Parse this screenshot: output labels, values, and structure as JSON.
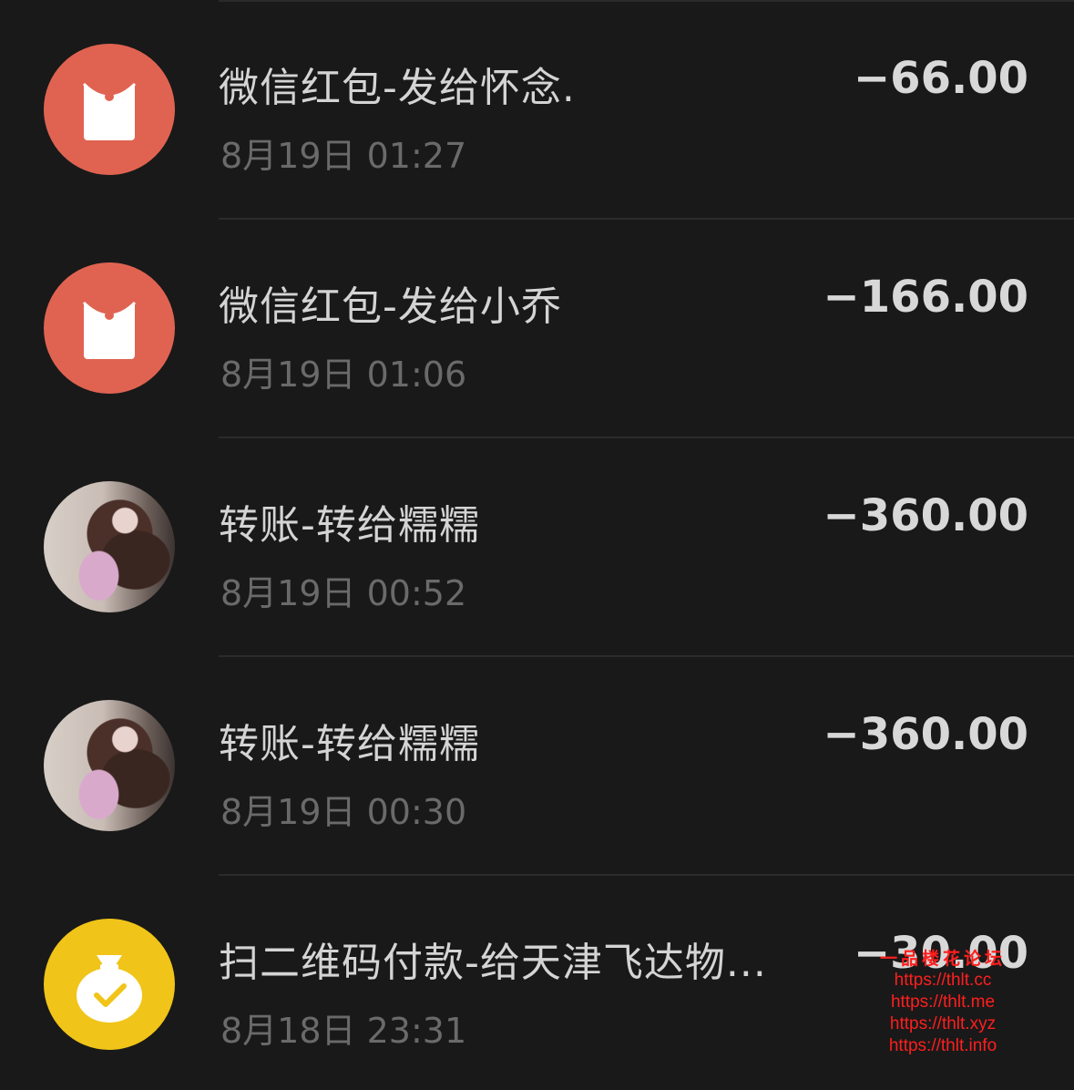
{
  "transactions": [
    {
      "title": "微信红包-发给怀念.",
      "time": "8月19日 01:27",
      "amount": "−66.00",
      "icon": "red-packet-icon"
    },
    {
      "title": "微信红包-发给小乔",
      "time": "8月19日 01:06",
      "amount": "−166.00",
      "icon": "red-packet-icon"
    },
    {
      "title": "转账-转给糯糯",
      "time": "8月19日 00:52",
      "amount": "−360.00",
      "icon": "avatar-photo"
    },
    {
      "title": "转账-转给糯糯",
      "time": "8月19日 00:30",
      "amount": "−360.00",
      "icon": "avatar-photo"
    },
    {
      "title": "扫二维码付款-给天津飞达物...",
      "time": "8月18日 23:31",
      "amount": "−30.00",
      "icon": "money-bag-check-icon"
    }
  ],
  "watermark": {
    "title": "一品楼花论坛",
    "urls": [
      "https://thlt.cc",
      "https://thlt.me",
      "https://thlt.xyz",
      "https://thlt.info"
    ]
  },
  "colors": {
    "background": "#191919",
    "red_packet": "#e06351",
    "scan_pay": "#f0c419",
    "watermark": "#ff1e1e"
  }
}
